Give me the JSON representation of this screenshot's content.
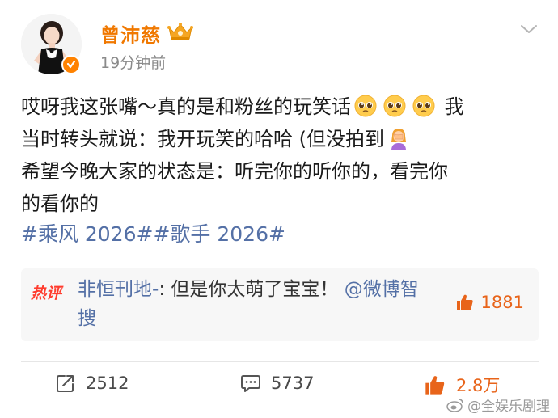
{
  "post": {
    "author": "曾沛慈",
    "time": "19分钟前",
    "text_line1_a": "哎呀我这张嘴～真的是和粉丝的玩笑话",
    "text_line1_b": "我",
    "text_line2": "当时转头就说：我开玩笑的哈哈 (但没拍到",
    "text_line3": "希望今晚大家的状态是：听完你的听你的，看完你",
    "text_line4": "的看你的",
    "hashtag1": "#乘风 2026#",
    "hashtag2": "#歌手 2026#"
  },
  "hot_comment": {
    "badge": "热评",
    "user": "非恒刊地-",
    "text": ": 但是你太萌了宝宝！",
    "link": "@微博智搜",
    "likes": "1881"
  },
  "actions": {
    "share_count": "2512",
    "comment_count": "5737",
    "like_count": "2.8万"
  },
  "watermark": "@全娱乐剧理",
  "colors": {
    "username": "#f07800",
    "link": "#5470a6",
    "like": "#e8641a",
    "hot_badge": "#ff3c2e"
  },
  "icons": {
    "crown": "vip-crown-icon",
    "verified": "verified-badge-icon",
    "menu": "chevron-down-icon",
    "pleading_emoji": "pleading-face-emoji",
    "facepalm_emoji": "facepalm-emoji",
    "share": "share-icon",
    "comment": "comment-icon",
    "like": "thumbs-up-icon"
  }
}
